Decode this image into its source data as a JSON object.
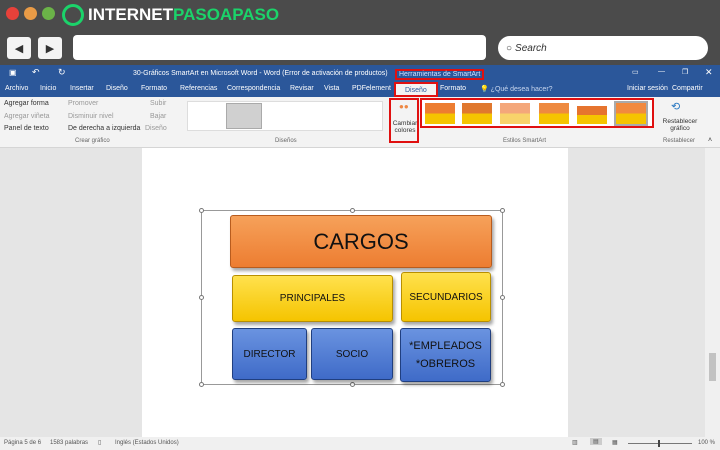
{
  "browser": {
    "logo_main": "INTERNET",
    "logo_accent": "PASOAPASO",
    "search_placeholder": "Search",
    "back": "◀",
    "forward": "▶"
  },
  "word": {
    "title": "30-Gráficos SmartArt en Microsoft Word - Word (Error de activación de productos)",
    "context_tab": "Herramientas de SmartArt",
    "tabs": [
      "Archivo",
      "Inicio",
      "Insertar",
      "Diseño",
      "Formato",
      "Referencias",
      "Correspondencia",
      "Revisar",
      "Vista",
      "PDFelement",
      "Diseño",
      "Formato"
    ],
    "tell_me": "¿Qué desea hacer?",
    "sign_in": "Iniciar sesión",
    "share": "Compartir"
  },
  "ribbon": {
    "crear": {
      "agregar_forma": "Agregar forma",
      "agregar_vineta": "Agregar viñeta",
      "panel_texto": "Panel de texto",
      "promover": "Promover",
      "disminuir": "Disminuir nivel",
      "derecha_izq": "De derecha a izquierda",
      "subir": "Subir",
      "bajar": "Bajar",
      "diseno": "Diseño",
      "label": "Crear gráfico"
    },
    "disenos_label": "Diseños",
    "cambiar_colores": "Cambiar colores",
    "estilos_label": "Estilos SmartArt",
    "restablecer": "Restablecer gráfico",
    "restablecer_label": "Restablecer"
  },
  "smartart": {
    "top": "CARGOS",
    "mid": [
      "PRINCIPALES",
      "SECUNDARIOS"
    ],
    "bottom": [
      "DIRECTOR",
      "SOCIO"
    ],
    "bottom_right": [
      "*EMPLEADOS",
      "*OBREROS"
    ]
  },
  "status": {
    "page": "Página 5 de 6",
    "words": "1583 palabras",
    "language": "Inglés (Estados Unidos)",
    "zoom": "100 %"
  }
}
